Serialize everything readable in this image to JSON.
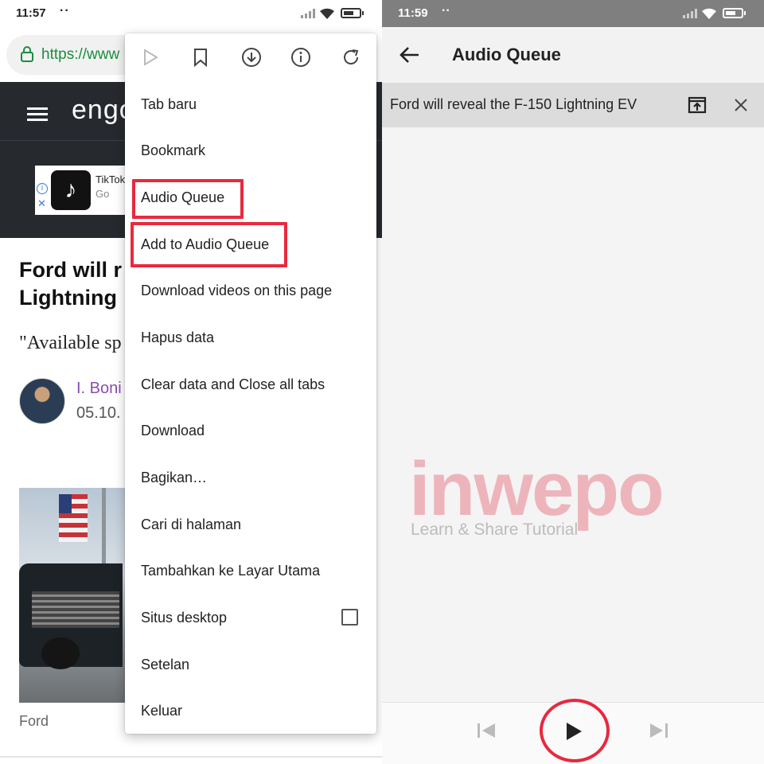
{
  "left": {
    "status_bar": {
      "time": "11:57",
      "dots": "··"
    },
    "url_text": "https://www",
    "site_logo": "engo",
    "ad": {
      "title": "TikTok",
      "subtitle": "Go"
    },
    "headline": "Ford will r\nLightning",
    "quote": "\"Available sp",
    "author": "I. Boni",
    "date": "05.10.",
    "caption": "Ford",
    "menu": {
      "toolbar_icons": [
        "forward-icon",
        "bookmark-icon",
        "download-icon",
        "info-icon",
        "refresh-icon"
      ],
      "items": [
        "Tab baru",
        "Bookmark",
        "Audio Queue",
        "Add to Audio Queue",
        "Download videos on this page",
        "Hapus data",
        "Clear data and Close all tabs",
        "Download",
        "Bagikan…",
        "Cari di halaman",
        "Tambahkan ke Layar Utama",
        "Situs desktop",
        "Setelan",
        "Keluar"
      ],
      "desktop_site_checked": false,
      "highlight_color": "#e8293e"
    }
  },
  "right": {
    "status_bar": {
      "time": "11:59",
      "dots": "··"
    },
    "title": "Audio Queue",
    "queue_item": "Ford will reveal the F-150 Lightning EV",
    "watermark": {
      "brand": "inwepo",
      "tagline": "Learn & Share Tutorial"
    }
  }
}
